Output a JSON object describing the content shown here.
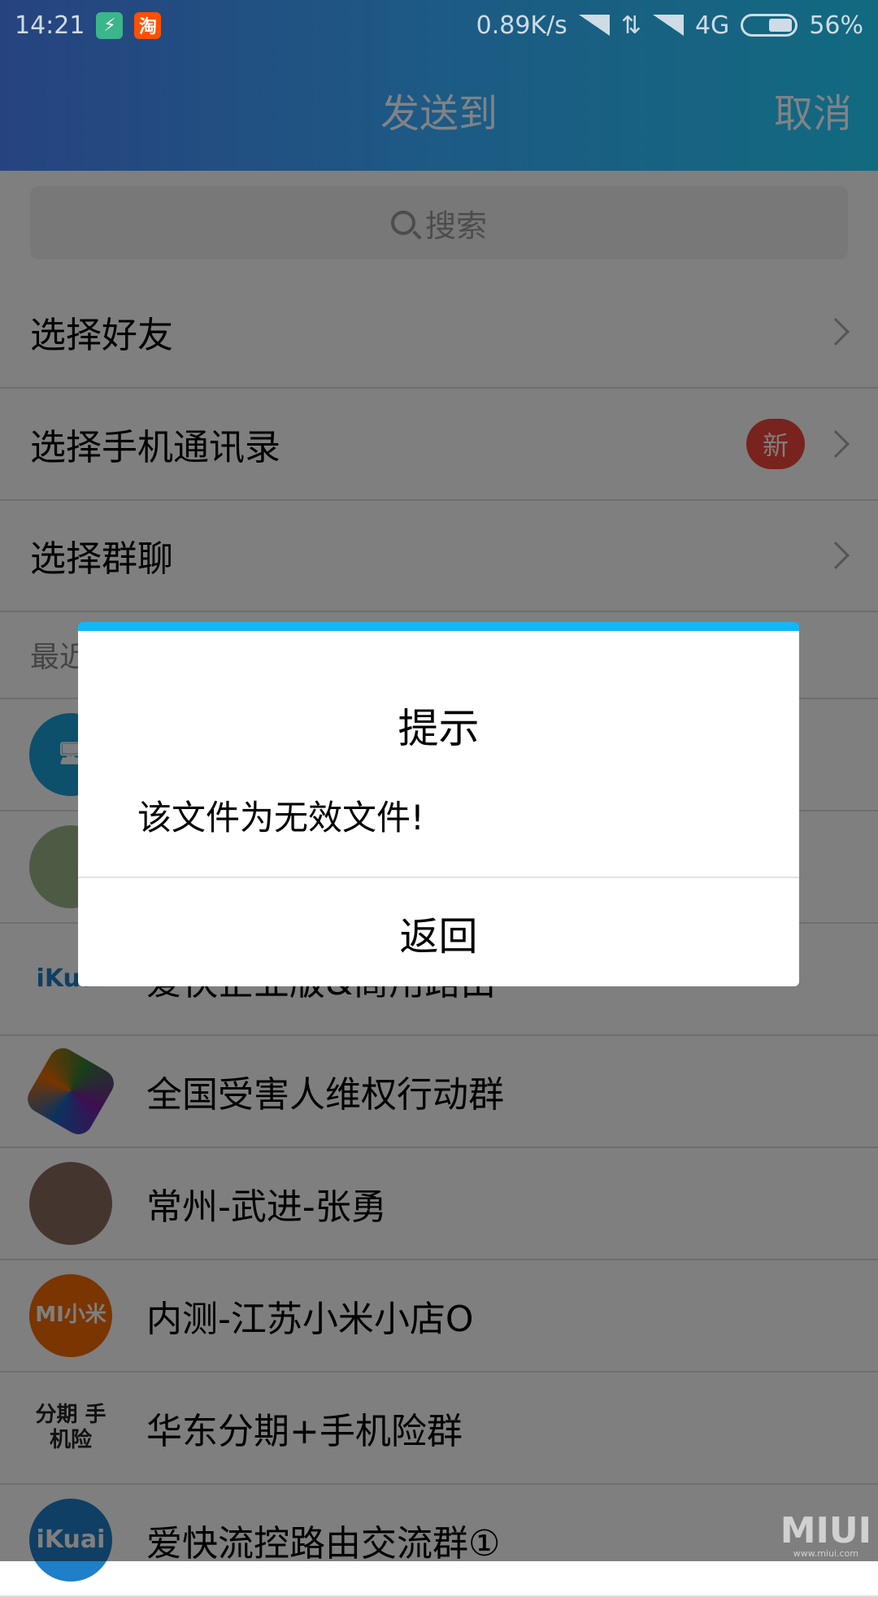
{
  "status_bar": {
    "time": "14:21",
    "app_icons": [
      "shield-bolt-icon",
      "taobao-icon"
    ],
    "taobao_char": "淘",
    "net_speed": "0.89K/s",
    "network": "4G",
    "battery": "56%",
    "battery_level": 0.56
  },
  "header": {
    "title": "发送到",
    "cancel": "取消"
  },
  "search": {
    "placeholder": "搜索"
  },
  "nav": [
    {
      "label": "选择好友"
    },
    {
      "label": "选择手机通讯录",
      "badge": "新"
    },
    {
      "label": "选择群聊"
    }
  ],
  "section": {
    "label": "最近"
  },
  "recent": [
    {
      "name": "",
      "avatar": "computer-icon",
      "color": "#1aa0d8"
    },
    {
      "name": "",
      "avatar": "photo",
      "color": "#9bb68a"
    },
    {
      "name": "爱快企业版&商用路由",
      "avatar": "ikuai-logo",
      "color": "#ffffff",
      "logo_text": "iKuai"
    },
    {
      "name": "全国受害人维权行动群",
      "avatar": "pinwheel-logo",
      "color": "#ffffff"
    },
    {
      "name": "常州-武进-张勇",
      "avatar": "photo",
      "color": "#8a6b5e"
    },
    {
      "name": "内测-江苏小米小店O",
      "avatar": "mi-logo",
      "color": "#f56a00",
      "logo_text": "MI小米"
    },
    {
      "name": "华东分期+手机险群",
      "avatar": "text-logo",
      "color": "#ffffff",
      "logo_text": "分期 手机险"
    },
    {
      "name": "爱快流控路由交流群①",
      "avatar": "ikuai-logo",
      "color": "#1f7fc8",
      "logo_text": "iKuai"
    }
  ],
  "dialog": {
    "title": "提示",
    "message": "该文件为无效文件!",
    "button": "返回",
    "accent": "#12b8f5"
  },
  "watermark": {
    "text": "MIUI",
    "sub": "www.miui.com"
  }
}
